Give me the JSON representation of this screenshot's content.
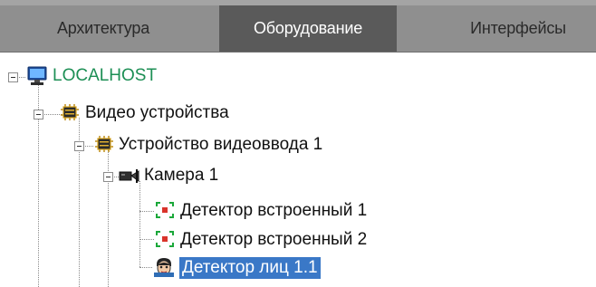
{
  "tabs": [
    {
      "label": "Архитектура"
    },
    {
      "label": "Оборудование"
    },
    {
      "label": "Интерфейсы"
    }
  ],
  "active_tab": "Оборудование",
  "tree": {
    "host": {
      "label": "LOCALHOST",
      "icon": "computer-icon"
    },
    "video_devices": {
      "label": "Видео устройства",
      "icon": "chip-icon"
    },
    "capture_device": {
      "label": "Устройство видеоввода 1",
      "icon": "chip-icon"
    },
    "camera": {
      "label": "Камера 1",
      "icon": "camera-icon"
    },
    "detectors": [
      {
        "label": "Детектор встроенный 1",
        "icon": "detector-frame-icon"
      },
      {
        "label": "Детектор встроенный 2",
        "icon": "detector-frame-icon"
      },
      {
        "label": "Детектор лиц 1.1",
        "icon": "face-detector-icon",
        "selected": true
      }
    ]
  },
  "colors": {
    "tab_bar": "#8f8f8f",
    "active_tab": "#5a5a5a",
    "host_text": "#1d8f55",
    "selection": "#3a78c7"
  }
}
